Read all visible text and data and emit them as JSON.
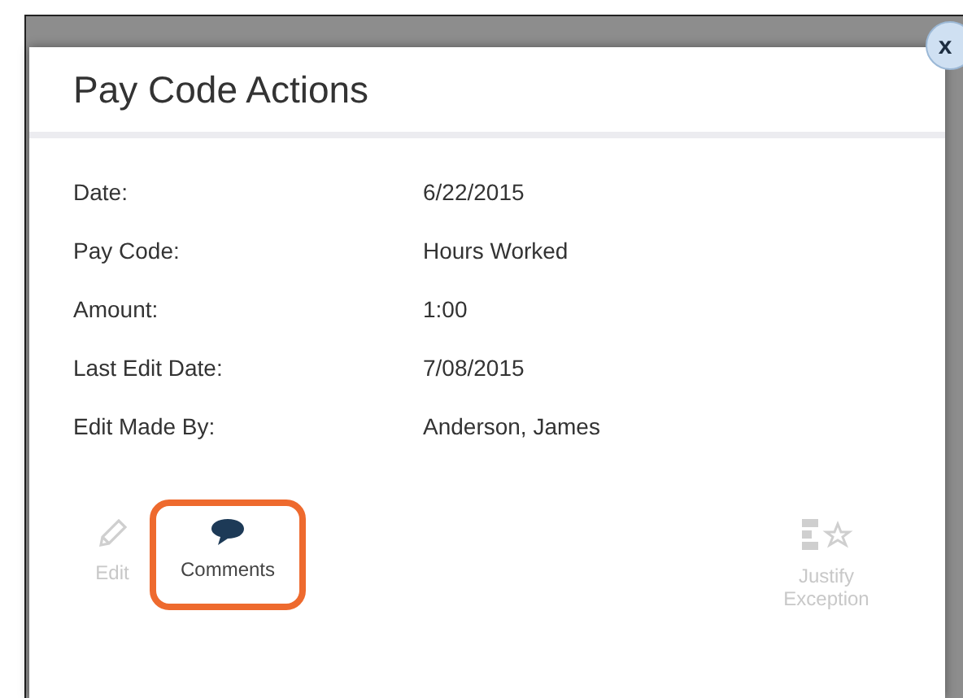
{
  "dialog": {
    "title": "Pay Code Actions",
    "close_label": "x"
  },
  "fields": [
    {
      "label": "Date:",
      "value": "6/22/2015"
    },
    {
      "label": "Pay Code:",
      "value": "Hours Worked"
    },
    {
      "label": "Amount:",
      "value": "1:00"
    },
    {
      "label": "Last Edit Date:",
      "value": "7/08/2015"
    },
    {
      "label": "Edit Made By:",
      "value": "Anderson, James"
    }
  ],
  "actions": [
    {
      "kind": "edit",
      "label": "Edit",
      "disabled": true,
      "highlighted": false
    },
    {
      "kind": "comments",
      "label": "Comments",
      "disabled": false,
      "highlighted": true
    },
    {
      "kind": "justify",
      "label": "Justify Exception",
      "disabled": true,
      "highlighted": false
    }
  ]
}
